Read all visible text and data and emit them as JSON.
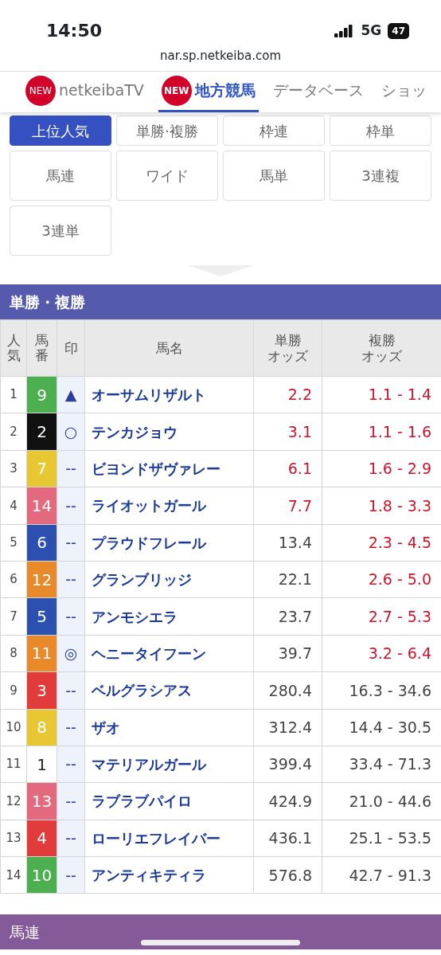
{
  "status_bar": {
    "time": "14:50",
    "network": "5G",
    "battery": "47"
  },
  "url": "nar.sp.netkeiba.com",
  "nav_tabs": [
    {
      "label": "netkeibaTV",
      "badge": "NEW",
      "selected": false
    },
    {
      "label": "地方競馬",
      "badge": "NEW",
      "selected": true
    },
    {
      "label": "データベース",
      "selected": false
    },
    {
      "label": "ショッ",
      "selected": false
    }
  ],
  "bet_types": [
    {
      "label": "上位人気",
      "selected": true
    },
    {
      "label": "単勝·複勝",
      "selected": false
    },
    {
      "label": "枠連",
      "selected": false
    },
    {
      "label": "枠単",
      "selected": false
    },
    {
      "label": "馬連",
      "selected": false
    },
    {
      "label": "ワイド",
      "selected": false
    },
    {
      "label": "馬単",
      "selected": false
    },
    {
      "label": "3連複",
      "selected": false
    },
    {
      "label": "3連単",
      "selected": false
    }
  ],
  "section_title": "単勝・複勝",
  "table": {
    "columns": [
      [
        "人気"
      ],
      [
        "馬番"
      ],
      [
        "印"
      ],
      [
        "馬名"
      ],
      [
        "単勝",
        "オッズ"
      ],
      [
        "複勝",
        "オッズ"
      ]
    ],
    "rows": [
      {
        "rank": "1",
        "number": "9",
        "color": "#4caf50",
        "mark": "▲",
        "name": "オーサムリザルト",
        "win": "2.2",
        "place": "1.1 - 1.4",
        "win_hot": true,
        "place_hot": true
      },
      {
        "rank": "2",
        "number": "2",
        "color": "#111111",
        "mark": "○",
        "name": "テンカジョウ",
        "win": "3.1",
        "place": "1.1 - 1.6",
        "win_hot": true,
        "place_hot": true
      },
      {
        "rank": "3",
        "number": "7",
        "color": "#e8c832",
        "mark": "--",
        "name": "ビヨンドザヴァレー",
        "win": "6.1",
        "place": "1.6 - 2.9",
        "win_hot": true,
        "place_hot": true
      },
      {
        "rank": "4",
        "number": "14",
        "color": "#e36a7e",
        "mark": "--",
        "name": "ライオットガール",
        "win": "7.7",
        "place": "1.8 - 3.3",
        "win_hot": true,
        "place_hot": true
      },
      {
        "rank": "5",
        "number": "6",
        "color": "#2b50b0",
        "mark": "--",
        "name": "プラウドフレール",
        "win": "13.4",
        "place": "2.3 - 4.5",
        "win_hot": false,
        "place_hot": true
      },
      {
        "rank": "6",
        "number": "12",
        "color": "#e8892a",
        "mark": "--",
        "name": "グランブリッジ",
        "win": "22.1",
        "place": "2.6 - 5.0",
        "win_hot": false,
        "place_hot": true
      },
      {
        "rank": "7",
        "number": "5",
        "color": "#2b50b0",
        "mark": "--",
        "name": "アンモシエラ",
        "win": "23.7",
        "place": "2.7 - 5.3",
        "win_hot": false,
        "place_hot": true
      },
      {
        "rank": "8",
        "number": "11",
        "color": "#e8892a",
        "mark": "◎",
        "name": "ヘニータイフーン",
        "win": "39.7",
        "place": "3.2 - 6.4",
        "win_hot": false,
        "place_hot": true
      },
      {
        "rank": "9",
        "number": "3",
        "color": "#e23b3b",
        "mark": "--",
        "name": "ベルグラシアス",
        "win": "280.4",
        "place": "16.3 - 34.6",
        "win_hot": false,
        "place_hot": false
      },
      {
        "rank": "10",
        "number": "8",
        "color": "#e8c832",
        "mark": "--",
        "name": "ザオ",
        "win": "312.4",
        "place": "14.4 - 30.5",
        "win_hot": false,
        "place_hot": false
      },
      {
        "rank": "11",
        "number": "1",
        "color": "#ffffff",
        "mark": "--",
        "name": "マテリアルガール",
        "win": "399.4",
        "place": "33.4 - 71.3",
        "win_hot": false,
        "place_hot": false
      },
      {
        "rank": "12",
        "number": "13",
        "color": "#e36a7e",
        "mark": "--",
        "name": "ラブラブパイロ",
        "win": "424.9",
        "place": "21.0 - 44.6",
        "win_hot": false,
        "place_hot": false
      },
      {
        "rank": "13",
        "number": "4",
        "color": "#e23b3b",
        "mark": "--",
        "name": "ローリエフレイバー",
        "win": "436.1",
        "place": "25.1 - 53.5",
        "win_hot": false,
        "place_hot": false
      },
      {
        "rank": "14",
        "number": "10",
        "color": "#4caf50",
        "mark": "--",
        "name": "アンティキティラ",
        "win": "576.8",
        "place": "42.7 - 91.3",
        "win_hot": false,
        "place_hot": false
      }
    ]
  },
  "next_section_title": "馬連"
}
